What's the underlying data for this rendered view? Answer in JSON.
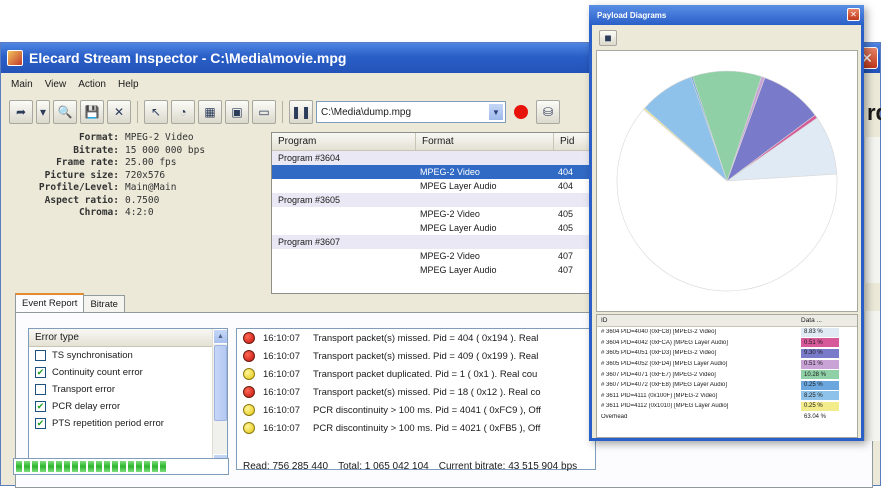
{
  "main_window": {
    "title": "Elecard Stream Inspector - C:\\Media\\movie.mpg",
    "partial_text_right": "rd"
  },
  "menu": [
    "Main",
    "View",
    "Action",
    "Help"
  ],
  "toolbar": {
    "path_value": "C:\\Media\\dump.mpg",
    "icons": [
      "open-arrow-icon",
      "dropdown-icon",
      "search-icon",
      "save-icon",
      "close-icon",
      "cursor-icon",
      "stream-icon",
      "chart-icon",
      "picture-icon",
      "monitor-icon",
      "pause-icon",
      "record-icon",
      "disk-icon"
    ]
  },
  "info": [
    {
      "label": "Format:",
      "value": "MPEG-2 Video"
    },
    {
      "label": "Bitrate:",
      "value": "15 000 000 bps"
    },
    {
      "label": "Frame rate:",
      "value": "25.00 fps"
    },
    {
      "label": "Picture size:",
      "value": "720x576"
    },
    {
      "label": "Profile/Level:",
      "value": "Main@Main"
    },
    {
      "label": "Aspect ratio:",
      "value": "0.7500"
    },
    {
      "label": "Chroma:",
      "value": "4:2:0"
    }
  ],
  "program_table": {
    "headers": [
      "Program",
      "Format",
      "Pid"
    ],
    "rows": [
      {
        "program": "Program #3604",
        "format": "",
        "pid": ""
      },
      {
        "program": "",
        "format": "MPEG-2 Video",
        "pid": "404"
      },
      {
        "program": "",
        "format": "MPEG Layer Audio",
        "pid": "404"
      },
      {
        "program": "Program #3605",
        "format": "",
        "pid": ""
      },
      {
        "program": "",
        "format": "MPEG-2 Video",
        "pid": "405"
      },
      {
        "program": "",
        "format": "MPEG Layer Audio",
        "pid": "405"
      },
      {
        "program": "Program #3607",
        "format": "",
        "pid": ""
      },
      {
        "program": "",
        "format": "MPEG-2 Video",
        "pid": "407"
      },
      {
        "program": "",
        "format": "MPEG Layer Audio",
        "pid": "407"
      }
    ]
  },
  "tabs": [
    "Event Report",
    "Bitrate"
  ],
  "error_types": {
    "header": "Error type",
    "items": [
      {
        "label": "TS synchronisation",
        "checked": false
      },
      {
        "label": "Continuity count error",
        "checked": true
      },
      {
        "label": "Transport error",
        "checked": false
      },
      {
        "label": "PCR delay error",
        "checked": true
      },
      {
        "label": "PTS repetition period error",
        "checked": true
      }
    ]
  },
  "events": [
    {
      "level": "red",
      "time": "16:10:07",
      "text": "Transport packet(s) missed. Pid = 404 ( 0x194 ). Real"
    },
    {
      "level": "red",
      "time": "16:10:07",
      "text": "Transport packet(s) missed. Pid = 409 ( 0x199 ). Real"
    },
    {
      "level": "yellow",
      "time": "16:10:07",
      "text": "Transport packet duplicated. Pid = 1 ( 0x1 ). Real cou"
    },
    {
      "level": "red",
      "time": "16:10:07",
      "text": "Transport packet(s) missed. Pid = 18 ( 0x12 ). Real co"
    },
    {
      "level": "yellow",
      "time": "16:10:07",
      "text": "PCR discontinuity > 100 ms. Pid = 4041 ( 0xFC9 ), Off"
    },
    {
      "level": "yellow",
      "time": "16:10:07",
      "text": "PCR discontinuity > 100 ms. Pid = 4021 ( 0xFB5 ), Off"
    }
  ],
  "status": {
    "progress_fraction": 0.72,
    "read": "Read: 756 285 440",
    "total": "Total: 1 065 042 104",
    "bitrate": "Current bitrate: 43 515 904 bps"
  },
  "payload_window": {
    "title": "Payload Diagrams",
    "legend_headers": [
      "ID",
      "Data ..."
    ],
    "legend_rows": [
      {
        "id": "# 3604 PID=4040 (0xFC8) [MPEG-2 Video]",
        "value": "8.83 %",
        "color": "#dfeaf5"
      },
      {
        "id": "# 3604 PID=4042 (0xFCA) [MPEG Layer Audio]",
        "value": "0.51 %",
        "color": "#d65a9a"
      },
      {
        "id": "# 3605 PID=4051 (0xFD3) [MPEG-2 Video]",
        "value": "9.30 %",
        "color": "#7a7acb"
      },
      {
        "id": "# 3605 PID=4052 (0xFD4) [MPEG Layer Audio]",
        "value": "0.51 %",
        "color": "#c9a3d6"
      },
      {
        "id": "# 3607 PID=4071 (0xFE7) [MPEG-2 Video]",
        "value": "10.28 %",
        "color": "#8fd0a6"
      },
      {
        "id": "# 3607 PID=4072 (0xFE8) [MPEG Layer Audio]",
        "value": "0.25 %",
        "color": "#6ba7de"
      },
      {
        "id": "# 3611 PID=4111 (0x100F) [MPEG-2 Video]",
        "value": "8.25 %",
        "color": "#8fc2ea"
      },
      {
        "id": "# 3611 PID=4112 (0x1010) [MPEG Layer Audio]",
        "value": "0.25 %",
        "color": "#f3ec8a"
      },
      {
        "id": "Overhead",
        "value": "63.04 %",
        "color": "#ffffff"
      }
    ]
  },
  "chart_data": {
    "type": "pie",
    "series": [
      {
        "name": "# 3604 PID=4040 (0xFC8) [MPEG-2 Video]",
        "value": 8.83,
        "color": "#dfeaf5"
      },
      {
        "name": "# 3604 PID=4042 (0xFCA) [MPEG Layer Audio]",
        "value": 0.51,
        "color": "#d65a9a"
      },
      {
        "name": "# 3605 PID=4051 (0xFD3) [MPEG-2 Video]",
        "value": 9.3,
        "color": "#7a7acb"
      },
      {
        "name": "# 3605 PID=4052 (0xFD4) [MPEG Layer Audio]",
        "value": 0.51,
        "color": "#c9a3d6"
      },
      {
        "name": "# 3607 PID=4071 (0xFE7) [MPEG-2 Video]",
        "value": 10.28,
        "color": "#8fd0a6"
      },
      {
        "name": "# 3607 PID=4072 (0xFE8) [MPEG Layer Audio]",
        "value": 0.25,
        "color": "#6ba7de"
      },
      {
        "name": "# 3611 PID=4111 (0x100F) [MPEG-2 Video]",
        "value": 8.25,
        "color": "#8fc2ea"
      },
      {
        "name": "# 3611 PID=4112 (0x1010) [MPEG Layer Audio]",
        "value": 0.25,
        "color": "#f3ec8a"
      },
      {
        "name": "Overhead",
        "value": 63.04,
        "color": "#ffffff"
      }
    ]
  }
}
